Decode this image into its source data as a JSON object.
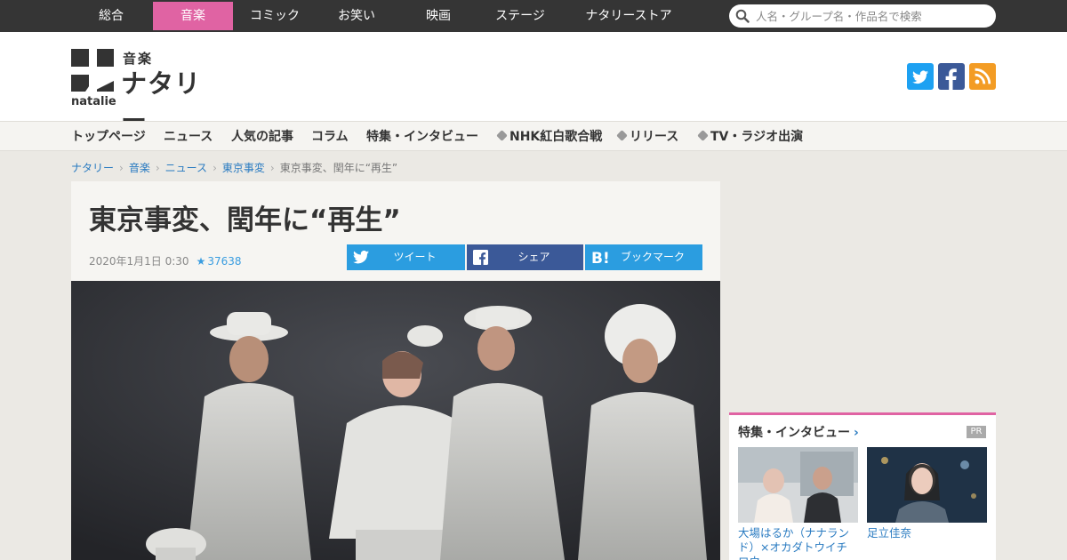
{
  "global_nav": {
    "tabs": [
      {
        "label": "総合"
      },
      {
        "label": "音楽"
      },
      {
        "label": "コミック"
      },
      {
        "label": "お笑い"
      },
      {
        "label": "映画"
      },
      {
        "label": "ステージ"
      },
      {
        "label": "ナタリーストア"
      }
    ],
    "active_tab": "音楽",
    "search_placeholder": "人名・グループ名・作品名で検索"
  },
  "header": {
    "logo_genre": "音楽",
    "logo_name": "ナタリー",
    "logo_latin": "natalie",
    "social_icons": [
      "twitter-icon",
      "facebook-icon",
      "rss-icon"
    ]
  },
  "sub_nav": {
    "items": [
      {
        "label": "トップページ"
      },
      {
        "label": "ニュース"
      },
      {
        "label": "人気の記事"
      },
      {
        "label": "コラム"
      },
      {
        "label": "特集・インタビュー"
      },
      {
        "label": "NHK紅白歌合戦"
      },
      {
        "label": "リリース"
      },
      {
        "label": "TV・ラジオ出演"
      }
    ]
  },
  "breadcrumb": {
    "items": [
      {
        "label": "ナタリー"
      },
      {
        "label": "音楽"
      },
      {
        "label": "ニュース"
      },
      {
        "label": "東京事変"
      }
    ],
    "current": "東京事変、閏年に“再生”"
  },
  "article": {
    "title": "東京事変、閏年に“再生”",
    "date": "2020年1月1日 0:30",
    "favorite_count": "37638",
    "share": {
      "tweet": "ツイート",
      "facebook": "シェア",
      "hatena": "ブックマーク"
    }
  },
  "sidebar": {
    "title": "特集・インタビュー",
    "pr_label": "PR",
    "cards": [
      {
        "caption": "大場はるか（ナナランド）×オカダトウイチロウ"
      },
      {
        "caption": "足立佳奈"
      }
    ]
  },
  "colors": {
    "accent_pink": "#e063a3",
    "link_blue": "#2a7bc1",
    "twitter_blue": "#2b9de0",
    "facebook_blue": "#3b5998",
    "rss_orange": "#f39c24"
  }
}
